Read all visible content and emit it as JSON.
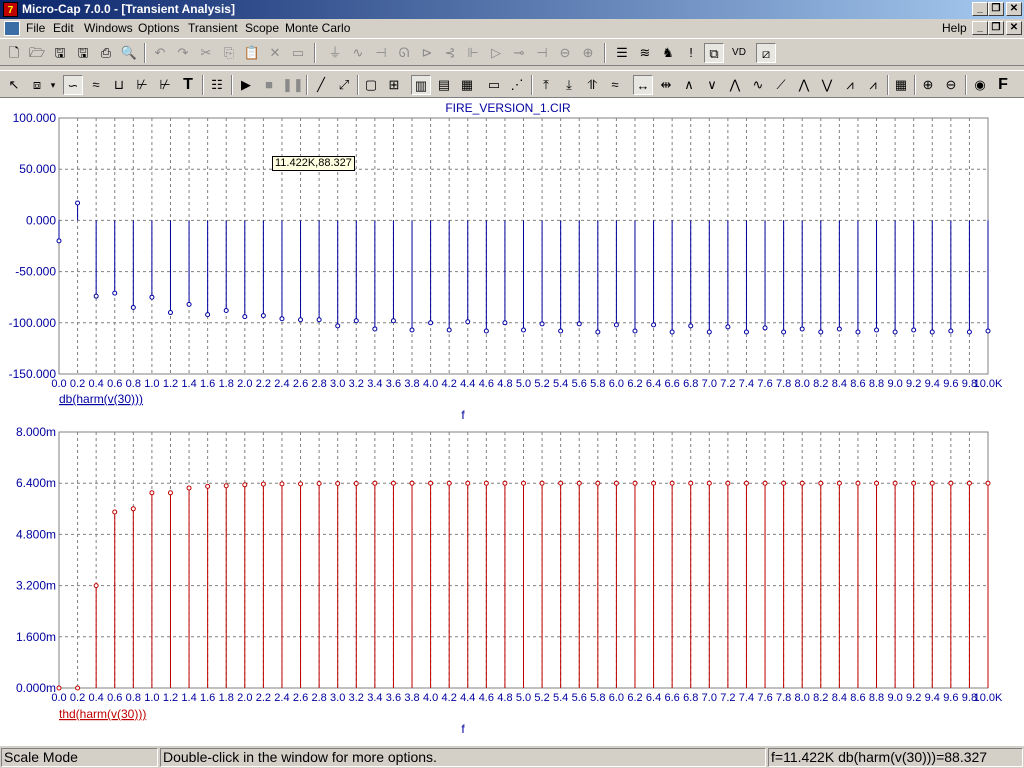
{
  "window": {
    "title": "Micro-Cap 7.0.0 - [Transient Analysis]",
    "app_icon_text": "7",
    "buttons": [
      "minimize-icon",
      "restore-icon",
      "close-icon"
    ]
  },
  "menu": {
    "items": [
      "File",
      "Edit",
      "Windows",
      "Options",
      "Transient",
      "Scope",
      "Monte Carlo"
    ],
    "help": "Help"
  },
  "toolbar1": {
    "icons": [
      "new-file-icon",
      "open-folder-icon",
      "save-icon",
      "save-all-icon",
      "print-icon",
      "print-preview-icon",
      "undo-icon",
      "redo-icon",
      "cut-icon",
      "copy-icon",
      "paste-icon",
      "delete-icon",
      "clear-icon",
      "ground-icon",
      "resistor-icon",
      "capacitor-icon",
      "inductor-icon",
      "diode-icon",
      "npn-icon",
      "jfet-icon",
      "opamp-icon",
      "battery-icon",
      "source-icon",
      "dc-source-icon",
      "component-list-icon",
      "wave-icon",
      "transformer-icon",
      "probe-icon",
      "window-icon",
      "vdd-icon",
      "zoom-window-icon"
    ]
  },
  "toolbar2": {
    "icons": [
      "select-arrow-icon",
      "component-mode-icon",
      "dropdown-icon",
      "scale-mode-icon",
      "cursor-mode-icon",
      "point-tag-icon",
      "horizontal-tag-icon",
      "vertical-tag-icon",
      "text-mode-icon",
      "properties-icon",
      "run-icon",
      "stop-icon",
      "pause-icon",
      "line-icon",
      "diagonal-line-icon",
      "box-icon",
      "grid-icon",
      "grid-minor-icon",
      "table-icon",
      "table-alt-icon",
      "horizontal-axis-icon",
      "data-points-icon",
      "peak-icon",
      "valley-icon",
      "high-icon",
      "low-icon",
      "left-cursor-icon",
      "right-cursor-icon",
      "slope-icon",
      "inflection-icon",
      "peak-valley-icon",
      "global-high-icon",
      "global-low-icon",
      "peak-cursor-icon",
      "valley-cursor-icon",
      "wave-cursor-icon",
      "numeric-output-icon",
      "zoom-in-icon",
      "zoom-out-icon",
      "center-icon",
      "font-icon"
    ]
  },
  "plot": {
    "file_title": "FIRE_VERSION_1.CIR",
    "tooltip": "11.422K,88.327",
    "x_axis_label": "f",
    "x_tick_labels": [
      "0.0",
      "0.2",
      "0.4",
      "0.6",
      "0.8",
      "1.0",
      "1.2",
      "1.4",
      "1.6",
      "1.8",
      "2.0",
      "2.2",
      "2.4",
      "2.6",
      "2.8",
      "3.0",
      "3.2",
      "3.4",
      "3.6",
      "3.8",
      "4.0",
      "4.2",
      "4.4",
      "4.6",
      "4.8",
      "5.0",
      "5.2",
      "5.4",
      "5.6",
      "5.8",
      "6.0",
      "6.2",
      "6.4",
      "6.6",
      "6.8",
      "7.0",
      "7.2",
      "7.4",
      "7.6",
      "7.8",
      "8.0",
      "8.2",
      "8.4",
      "8.6",
      "8.8",
      "9.0",
      "9.2",
      "9.4",
      "9.6",
      "9.8",
      "10.0K"
    ]
  },
  "chart_data": [
    {
      "type": "bar",
      "title": "FIRE_VERSION_1.CIR",
      "xlabel": "f",
      "ylabel": "",
      "series": [
        {
          "name": "db(harm(v(30)))",
          "color": "#0000a0",
          "values": [
            -20,
            17,
            -74,
            -71,
            -85,
            -75,
            -90,
            -82,
            -92,
            -88,
            -94,
            -93,
            -96,
            -97,
            -97,
            -103,
            -98,
            -106,
            -98,
            -107,
            -100,
            -107,
            -99,
            -108,
            -100,
            -107,
            -101,
            -108,
            -101,
            -109,
            -102,
            -108,
            -102,
            -109,
            -103,
            -109,
            -104,
            -109,
            -105,
            -109,
            -106,
            -109,
            -106,
            -109,
            -107,
            -109,
            -107,
            -109,
            -108,
            -109,
            -108
          ]
        }
      ],
      "yticks": [
        "100.000",
        "50.000",
        "0.000",
        "-50.000",
        "-100.000",
        "-150.000"
      ],
      "ylim": [
        -150,
        100
      ],
      "grid": true
    },
    {
      "type": "bar",
      "xlabel": "f",
      "ylabel": "",
      "series": [
        {
          "name": "thd(harm(v(30)))",
          "color": "#c00000",
          "values": [
            0,
            0,
            3.2,
            5.5,
            5.6,
            6.1,
            6.1,
            6.25,
            6.3,
            6.32,
            6.35,
            6.37,
            6.38,
            6.38,
            6.39,
            6.39,
            6.39,
            6.4,
            6.4,
            6.4,
            6.4,
            6.4,
            6.4,
            6.4,
            6.4,
            6.4,
            6.4,
            6.4,
            6.4,
            6.4,
            6.4,
            6.4,
            6.4,
            6.4,
            6.4,
            6.4,
            6.4,
            6.4,
            6.4,
            6.4,
            6.4,
            6.4,
            6.4,
            6.4,
            6.4,
            6.4,
            6.4,
            6.4,
            6.4,
            6.4,
            6.4
          ]
        }
      ],
      "yticks": [
        "8.000m",
        "6.400m",
        "4.800m",
        "3.200m",
        "1.600m",
        "0.000m"
      ],
      "ylim": [
        0,
        8
      ],
      "grid": true
    }
  ],
  "status": {
    "mode": "Scale Mode",
    "hint": "Double-click in the window for more options.",
    "readout": "f=11.422K db(harm(v(30)))=88.327"
  }
}
